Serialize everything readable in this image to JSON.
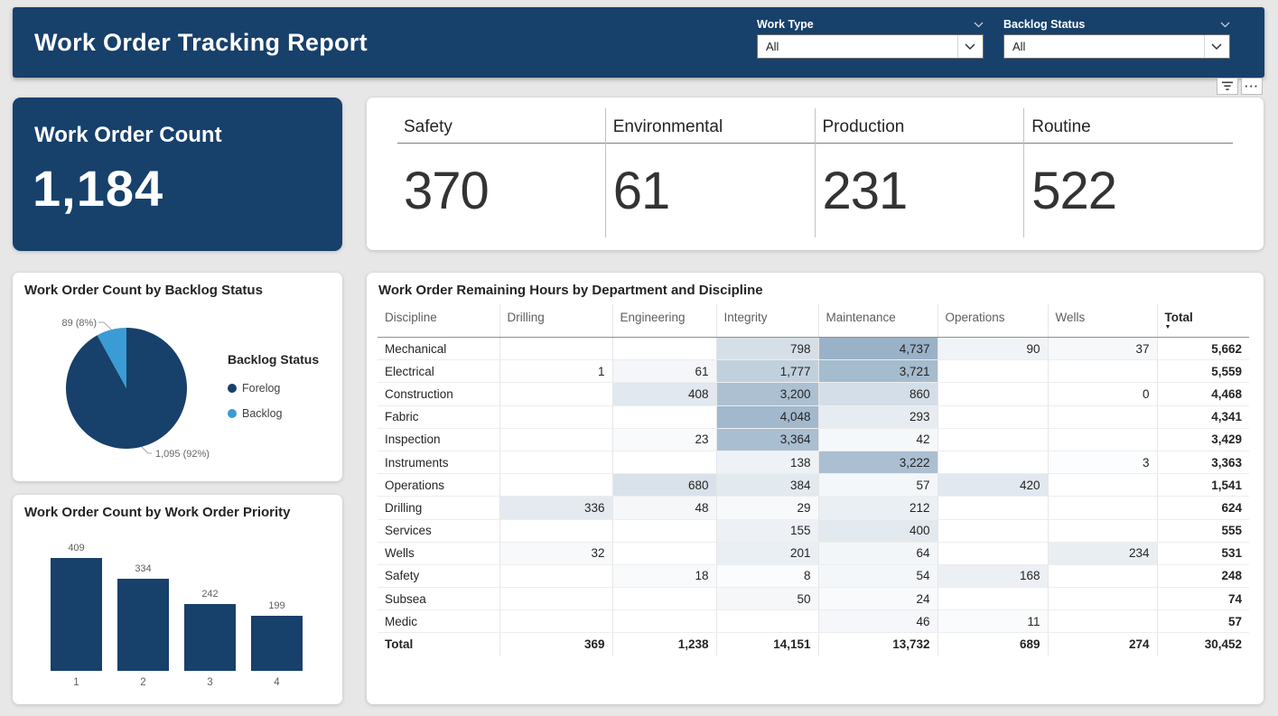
{
  "colors": {
    "navy": "#17406B",
    "light_blue": "#3A9BD5",
    "heat_max": "#9AB2C8",
    "page_bg": "#e7e7e7"
  },
  "header": {
    "title": "Work Order Tracking Report",
    "filters": [
      {
        "label": "Work Type",
        "value": "All"
      },
      {
        "label": "Backlog Status",
        "value": "All"
      }
    ]
  },
  "visual_toolbar": {
    "icons": [
      "filter-icon",
      "more-options-icon"
    ],
    "more_options_glyph": "···"
  },
  "kpi_card": {
    "title": "Work Order Count",
    "value": "1,184"
  },
  "category_card": {
    "items": [
      {
        "label": "Safety",
        "value": "370"
      },
      {
        "label": "Environmental",
        "value": "61"
      },
      {
        "label": "Production",
        "value": "231"
      },
      {
        "label": "Routine",
        "value": "522"
      }
    ]
  },
  "pie_card": {
    "title": "Work Order Count by Backlog Status",
    "legend_title": "Backlog Status",
    "chart_data": {
      "type": "pie",
      "categories": [
        "Forelog",
        "Backlog"
      ],
      "values": [
        1095,
        89
      ]
    },
    "slices": [
      {
        "label": "Forelog",
        "value": 1095,
        "pct": "92%",
        "callout": "1,095 (92%)",
        "color": "#17406B"
      },
      {
        "label": "Backlog",
        "value": 89,
        "pct": "8%",
        "callout": "89 (8%)",
        "color": "#3A9BD5"
      }
    ]
  },
  "bar_card": {
    "title": "Work Order Count by Work Order Priority",
    "chart_data": {
      "type": "bar",
      "categories": [
        "1",
        "2",
        "3",
        "4"
      ],
      "values": [
        409,
        334,
        242,
        199
      ],
      "ylim": [
        0,
        409
      ]
    }
  },
  "matrix_card": {
    "title": "Work Order Remaining Hours by Department and Discipline",
    "columns": [
      "Discipline",
      "Drilling",
      "Engineering",
      "Integrity",
      "Maintenance",
      "Operations",
      "Wells",
      "Total"
    ],
    "sorted_column": "Total",
    "rows": [
      [
        "Mechanical",
        null,
        null,
        798,
        4737,
        90,
        37,
        5662
      ],
      [
        "Electrical",
        1,
        61,
        1777,
        3721,
        null,
        null,
        5559
      ],
      [
        "Construction",
        null,
        408,
        3200,
        860,
        null,
        0,
        4468
      ],
      [
        "Fabric",
        null,
        null,
        4048,
        293,
        null,
        null,
        4341
      ],
      [
        "Inspection",
        null,
        23,
        3364,
        42,
        null,
        null,
        3429
      ],
      [
        "Instruments",
        null,
        null,
        138,
        3222,
        null,
        3,
        3363
      ],
      [
        "Operations",
        null,
        680,
        384,
        57,
        420,
        null,
        1541
      ],
      [
        "Drilling",
        336,
        48,
        29,
        212,
        null,
        null,
        624
      ],
      [
        "Services",
        null,
        null,
        155,
        400,
        null,
        null,
        555
      ],
      [
        "Wells",
        32,
        null,
        201,
        64,
        null,
        234,
        531
      ],
      [
        "Safety",
        null,
        18,
        8,
        54,
        168,
        null,
        248
      ],
      [
        "Subsea",
        null,
        null,
        50,
        24,
        null,
        null,
        74
      ],
      [
        "Medic",
        null,
        null,
        null,
        46,
        11,
        null,
        57
      ]
    ],
    "total_row": [
      "Total",
      369,
      1238,
      14151,
      13732,
      689,
      274,
      30452
    ]
  }
}
